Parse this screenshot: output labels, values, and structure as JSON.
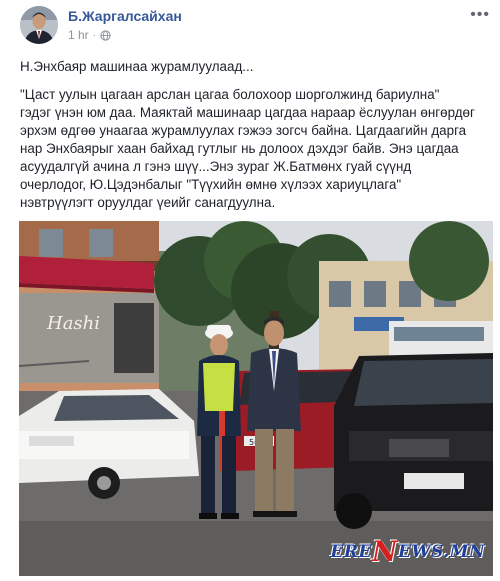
{
  "post": {
    "author": "Б.Жаргалсайхан",
    "timestamp": "1 hr",
    "separator": "·",
    "privacy_icon": "globe-icon",
    "more_label": "•••",
    "intro": "Н.Энхбаяр машинаа журамлуулаад...",
    "body_lines": [
      "\"Цаст уулын цагаан арслан цагаа болохоор шорголжинд бариулна\"",
      "гэдэг үнэн юм даа. Маяктай машинаар цагдаа нараар ёслуулан өнгөрдөг",
      "эрхэм өдгөө унаагаа журамлуулах гэжээ зогсч байна. Цагдаагийн дарга",
      "нар Энхбаярыг хаан байхад гутлыг нь долоох дэхдэг байв. Энэ цагдаа",
      "асуудалгүй ачина л гэнэ шүү...Энэ зураг Ж.Батмөнх гуай сүүнд",
      "очерлодог, Ю.Цэдэнбалыг \"Түүхийн өмнө хүлээх хариуцлага\"",
      "нэвтрүүлэгт оруулдаг үеийг санагдуулна."
    ]
  },
  "photo": {
    "shop_sign": "Hashi",
    "plate_left": "56-97",
    "plate_right": "",
    "watermark_main": "ERE",
    "watermark_n": "N",
    "watermark_tail": "EWS.MN"
  },
  "colors": {
    "author_link": "#365899",
    "meta_gray": "#90949c",
    "text": "#1d2129"
  }
}
